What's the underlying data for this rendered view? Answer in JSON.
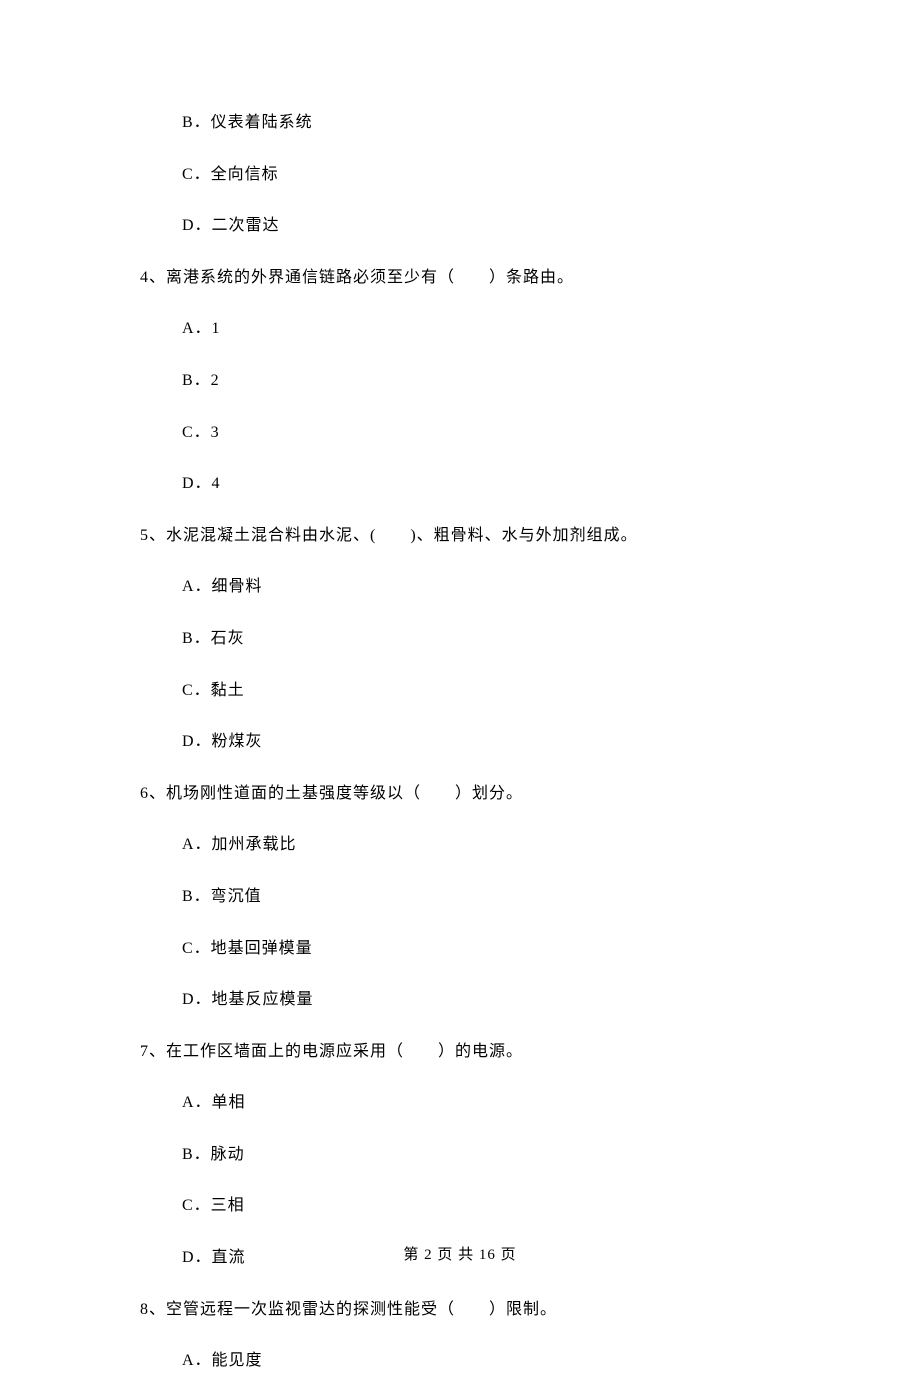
{
  "q3": {
    "optB": "B．仪表着陆系统",
    "optC": "C．全向信标",
    "optD": "D．二次雷达"
  },
  "q4": {
    "text": "4、离港系统的外界通信链路必须至少有（　　）条路由。",
    "optA": "A．1",
    "optB": "B．2",
    "optC": "C．3",
    "optD": "D．4"
  },
  "q5": {
    "text": "5、水泥混凝土混合料由水泥、(　　)、粗骨料、水与外加剂组成。",
    "optA": "A．细骨料",
    "optB": "B．石灰",
    "optC": "C．黏土",
    "optD": "D．粉煤灰"
  },
  "q6": {
    "text": "6、机场刚性道面的土基强度等级以（　　）划分。",
    "optA": "A．加州承载比",
    "optB": "B．弯沉值",
    "optC": "C．地基回弹模量",
    "optD": "D．地基反应模量"
  },
  "q7": {
    "text": "7、在工作区墙面上的电源应采用（　　）的电源。",
    "optA": "A．单相",
    "optB": "B．脉动",
    "optC": "C．三相",
    "optD": "D．直流"
  },
  "q8": {
    "text": "8、空管远程一次监视雷达的探测性能受（　　）限制。",
    "optA": "A．能见度"
  },
  "footer": "第 2 页 共 16 页"
}
